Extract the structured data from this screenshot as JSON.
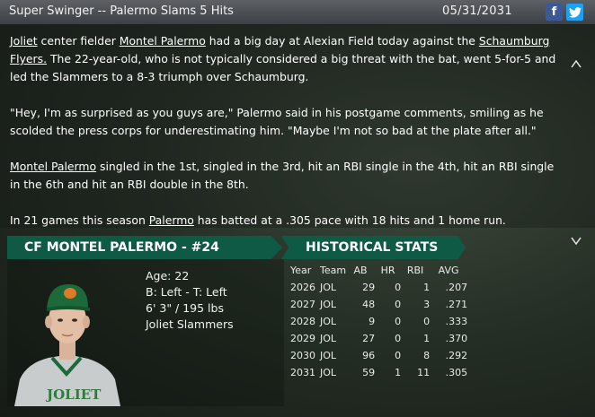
{
  "titlebar": {
    "title": "Super Swinger -- Palermo Slams 5 Hits",
    "date": "05/31/2031",
    "facebook_glyph": "f",
    "twitter_glyph": "t"
  },
  "article": {
    "p1": {
      "link_team": "Joliet",
      "t1": " center fielder ",
      "link_player": "Montel Palermo",
      "t2": " had a big day at Alexian Field today against the ",
      "link_opponent": "Schaumburg Flyers.",
      "t3": " The 22-year-old, who is not typically considered a big threat with the bat, went 5-for-5 and led the Slammers to a 8-3 triumph over Schaumburg."
    },
    "p2": "\"Hey, I'm as surprised as you guys are,\" Palermo said in his postgame comments, smiling as he scolded the press corps for underestimating him. \"Maybe I'm not so bad at the plate after all.\"",
    "p3": {
      "link_player": "Montel Palermo",
      "t1": " singled in the 1st, singled in the 3rd, hit an RBI single in the 4th, hit an RBI single in the 6th and hit an RBI double in the 8th."
    },
    "p4": {
      "t1": "In 21 games this season ",
      "link_player": "Palermo",
      "t2": " has batted at a .305 pace with 18 hits and 1 home run."
    },
    "scroll_up": "^",
    "scroll_down": "v"
  },
  "player": {
    "header": "CF MONTEL PALERMO - #24",
    "age": "Age: 22",
    "bats_throws": "B: Left - T: Left",
    "height_weight": "6' 3\" / 195 lbs",
    "team": "Joliet Slammers",
    "jersey_text": "JOLIET"
  },
  "historical": {
    "header": "HISTORICAL STATS",
    "columns": [
      "Year",
      "Team",
      "AB",
      "HR",
      "RBI",
      "AVG"
    ],
    "rows": [
      [
        "2026",
        "JOL",
        "29",
        "0",
        "1",
        ".207"
      ],
      [
        "2027",
        "JOL",
        "48",
        "0",
        "3",
        ".271"
      ],
      [
        "2028",
        "JOL",
        "9",
        "0",
        "0",
        ".333"
      ],
      [
        "2029",
        "JOL",
        "27",
        "0",
        "1",
        ".370"
      ],
      [
        "2030",
        "JOL",
        "96",
        "0",
        "8",
        ".292"
      ],
      [
        "2031",
        "JOL",
        "59",
        "1",
        "11",
        ".305"
      ]
    ]
  },
  "colors": {
    "header_green": "#0f5a44",
    "facebook": "#3b5998",
    "twitter": "#1da1f2"
  },
  "icons": [
    "facebook-icon",
    "twitter-icon",
    "scroll-up-icon",
    "scroll-down-icon"
  ]
}
